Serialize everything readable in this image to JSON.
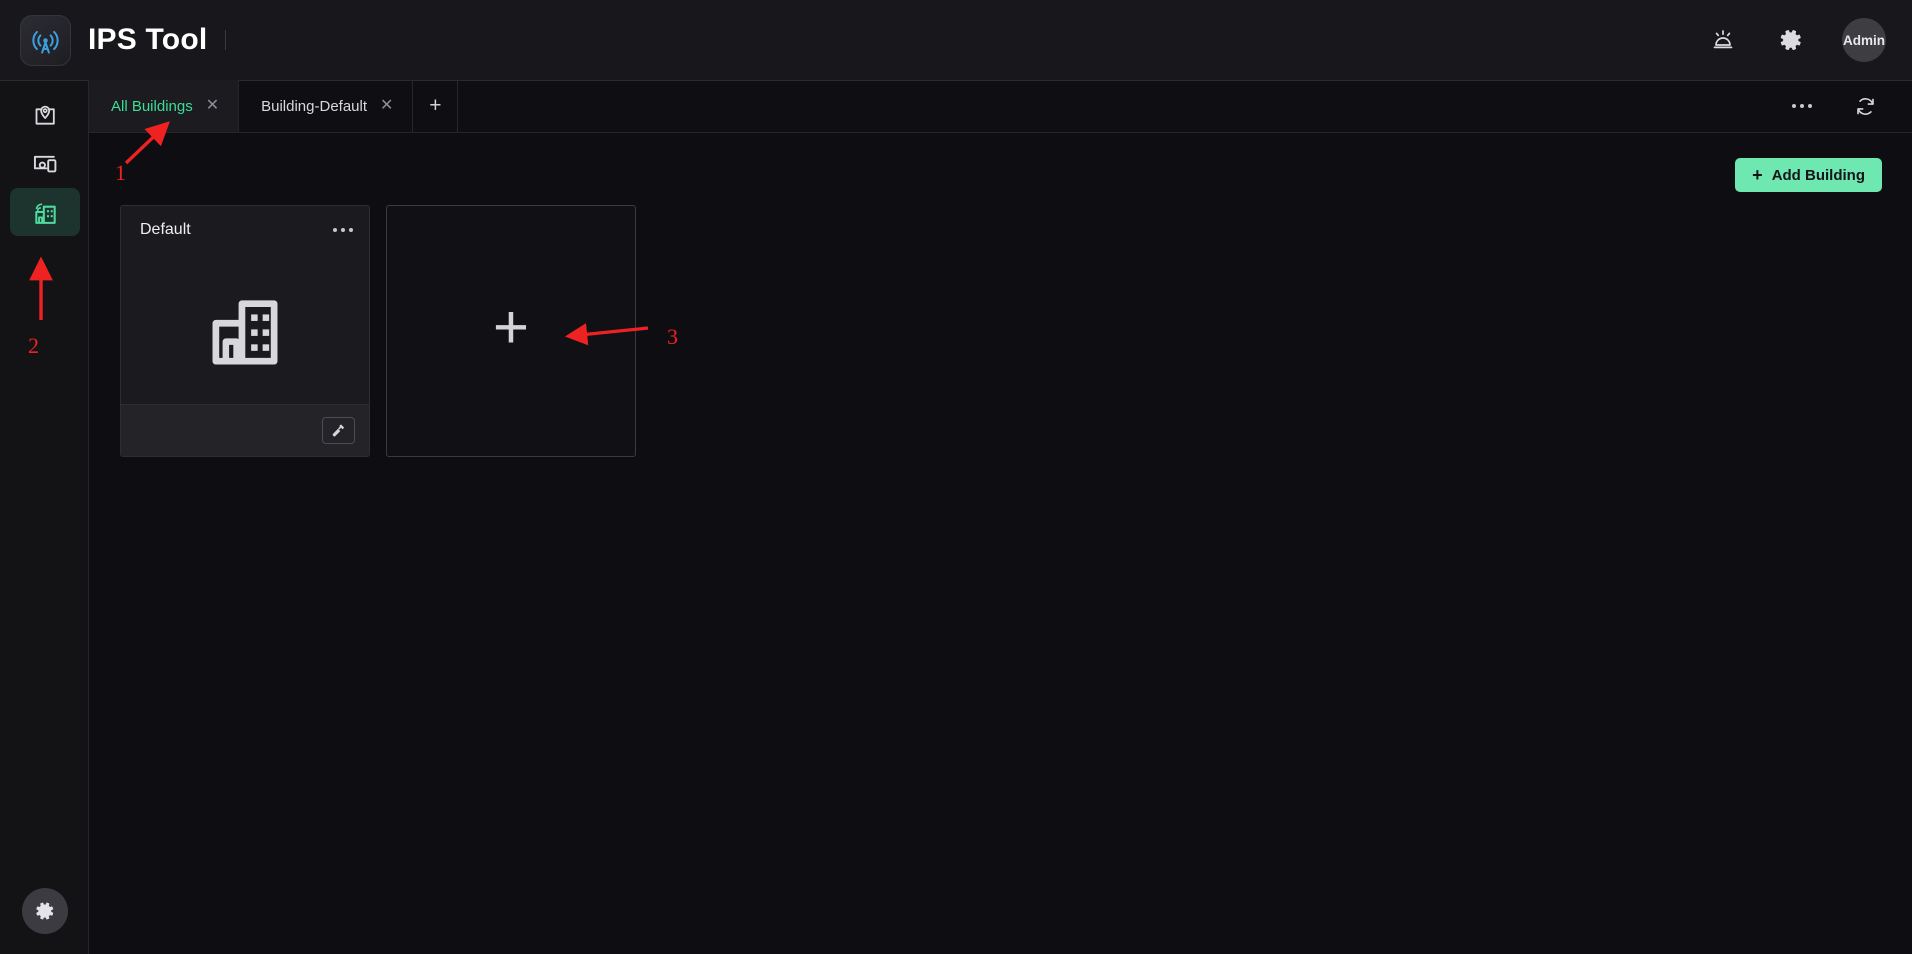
{
  "header": {
    "title": "IPS Tool",
    "logo_icon": "radio-tower-icon",
    "actions": [
      {
        "name": "alarm-icon",
        "label": "Alarm"
      },
      {
        "name": "gear-icon",
        "label": "Settings"
      }
    ],
    "avatar_label": "Admin"
  },
  "sidebar": {
    "items": [
      {
        "name": "sidebar-item-map",
        "icon": "map-pin-icon",
        "label": "Map",
        "active": false
      },
      {
        "name": "sidebar-item-devices",
        "icon": "devices-icon",
        "label": "Devices",
        "active": false
      },
      {
        "name": "sidebar-item-buildings",
        "icon": "building-icon",
        "label": "Buildings",
        "active": true
      }
    ],
    "bottom": {
      "name": "sidebar-settings-button",
      "icon": "gear-icon",
      "label": "Settings"
    }
  },
  "tabbar": {
    "tabs": [
      {
        "label": "All Buildings",
        "active": true,
        "close_glyph": "✕"
      },
      {
        "label": "Building-Default",
        "active": false,
        "close_glyph": "✕"
      }
    ],
    "add_tab_glyph": "+",
    "more_label": "More options",
    "refresh_label": "Refresh"
  },
  "content": {
    "add_building_button": {
      "plus": "+",
      "label": "Add Building"
    },
    "cards": [
      {
        "title": "Default",
        "menu_glyph": "···",
        "icon": "building-icon",
        "footer_tool_icon": "hammer-icon"
      }
    ],
    "add_card": {
      "glyph": "+",
      "label": "Add new building"
    }
  },
  "annotations": [
    {
      "number": "1",
      "target": "sidebar-item-buildings"
    },
    {
      "number": "2",
      "target": "tab-all-buildings"
    },
    {
      "number": "3",
      "target": "add-building-card"
    }
  ],
  "colors": {
    "accent_green": "#6ee7b0",
    "tab_active_green": "#3ddc97",
    "annotation_red": "#ef2222",
    "logo_blue": "#3b9ede",
    "header_bg": "#18181c",
    "content_bg": "#0e0e12"
  }
}
